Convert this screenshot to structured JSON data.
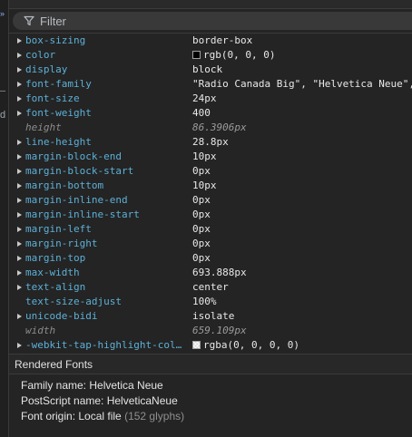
{
  "filter": {
    "placeholder": "Filter"
  },
  "properties": [
    {
      "name": "box-sizing",
      "value": "border-box",
      "expandable": true,
      "computed": false
    },
    {
      "name": "color",
      "value": "rgb(0, 0, 0)",
      "expandable": true,
      "computed": false,
      "swatch": "#000000"
    },
    {
      "name": "display",
      "value": "block",
      "expandable": true,
      "computed": false
    },
    {
      "name": "font-family",
      "value": "\"Radio Canada Big\", \"Helvetica Neue\",",
      "expandable": true,
      "computed": false
    },
    {
      "name": "font-size",
      "value": "24px",
      "expandable": true,
      "computed": false
    },
    {
      "name": "font-weight",
      "value": "400",
      "expandable": true,
      "computed": false
    },
    {
      "name": "height",
      "value": "86.3906px",
      "expandable": false,
      "computed": true
    },
    {
      "name": "line-height",
      "value": "28.8px",
      "expandable": true,
      "computed": false
    },
    {
      "name": "margin-block-end",
      "value": "10px",
      "expandable": true,
      "computed": false
    },
    {
      "name": "margin-block-start",
      "value": "0px",
      "expandable": true,
      "computed": false
    },
    {
      "name": "margin-bottom",
      "value": "10px",
      "expandable": true,
      "computed": false
    },
    {
      "name": "margin-inline-end",
      "value": "0px",
      "expandable": true,
      "computed": false
    },
    {
      "name": "margin-inline-start",
      "value": "0px",
      "expandable": true,
      "computed": false
    },
    {
      "name": "margin-left",
      "value": "0px",
      "expandable": true,
      "computed": false
    },
    {
      "name": "margin-right",
      "value": "0px",
      "expandable": true,
      "computed": false
    },
    {
      "name": "margin-top",
      "value": "0px",
      "expandable": true,
      "computed": false
    },
    {
      "name": "max-width",
      "value": "693.888px",
      "expandable": true,
      "computed": false
    },
    {
      "name": "text-align",
      "value": "center",
      "expandable": true,
      "computed": false
    },
    {
      "name": "text-size-adjust",
      "value": "100%",
      "expandable": false,
      "computed": false
    },
    {
      "name": "unicode-bidi",
      "value": "isolate",
      "expandable": true,
      "computed": false
    },
    {
      "name": "width",
      "value": "659.109px",
      "expandable": false,
      "computed": true
    },
    {
      "name": "-webkit-tap-highlight-col…",
      "value": "rgba(0, 0, 0, 0)",
      "expandable": true,
      "computed": false,
      "swatch": "checker"
    }
  ],
  "rendered_fonts": {
    "title": "Rendered Fonts",
    "family_line": "Family name: Helvetica Neue",
    "postscript_line": "PostScript name: HelveticaNeue",
    "origin_label": "Font origin: Local file",
    "origin_glyphs": "(152 glyphs)"
  },
  "gutter": {
    "mark_top": "»",
    "mark_mid": "—",
    "mark_low": "d"
  },
  "colors": {
    "property_name": "#5db0d7",
    "computed_name": "#8c8c8c",
    "value_text": "#e8e8e8",
    "background": "#242424"
  }
}
